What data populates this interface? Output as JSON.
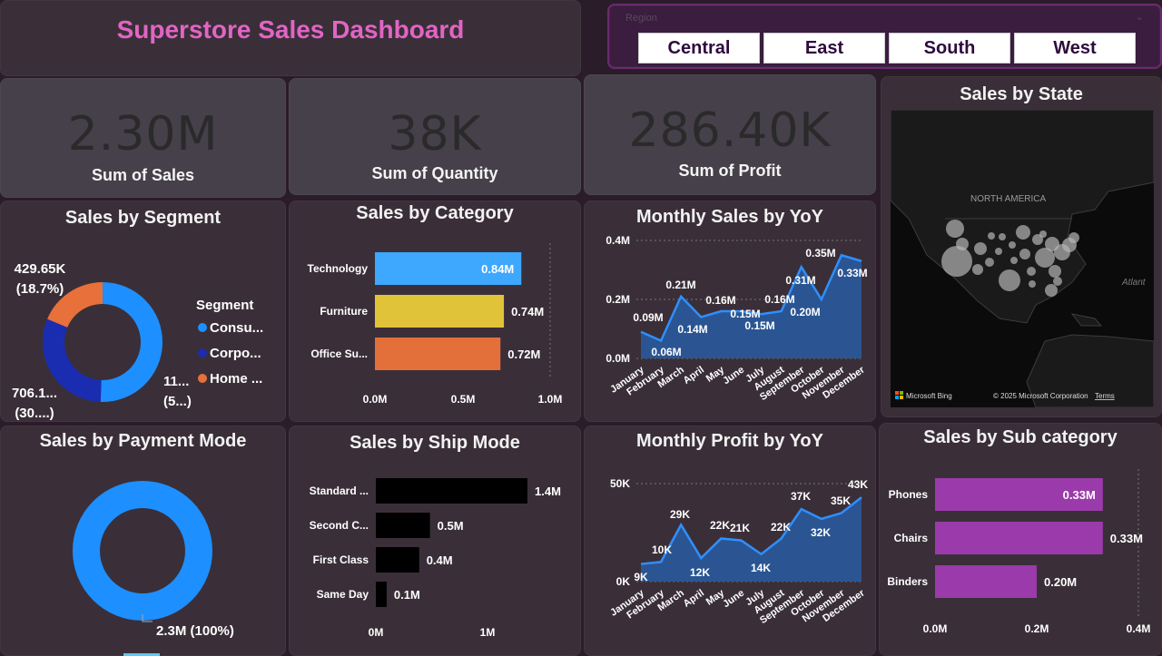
{
  "title": "Superstore Sales Dashboard",
  "region_slicer": {
    "label": "Region",
    "options": [
      "Central",
      "East",
      "South",
      "West"
    ]
  },
  "kpis": [
    {
      "value": "2.30M",
      "label": "Sum of Sales"
    },
    {
      "value": "38K",
      "label": "Sum of Quantity"
    },
    {
      "value": "286.40K",
      "label": "Sum of Profit"
    }
  ],
  "map": {
    "title": "Sales by State",
    "region_label": "NORTH AMERICA",
    "ocean_label": "Atlant",
    "provider": "Microsoft Bing",
    "copyright": "© 2025 Microsoft Corporation",
    "terms": "Terms"
  },
  "colors": {
    "bg": "#2b1c2a",
    "card": "#3a2f38",
    "title_pink": "#e065c4",
    "blue": "#1e8fff",
    "navy": "#1a2db0",
    "orange": "#e8703a",
    "tech_blue": "#3ea8ff",
    "furn_yellow": "#e1c33a",
    "office_orange": "#e3703a",
    "area_fill": "#2a5592",
    "area_line": "#2f8fff",
    "purple": "#9b3aab"
  },
  "chart_data": [
    {
      "id": "segment",
      "type": "pie",
      "title": "Sales by Segment",
      "legend_title": "Segment",
      "legend": [
        "Consu...",
        "Corpo...",
        "Home ..."
      ],
      "values": [
        1160000,
        706100,
        429650
      ],
      "labels": [
        "11...\n(5...)",
        "706.1...\n(30....)",
        "429.65K\n(18.7%)"
      ],
      "colors": [
        "#1e8fff",
        "#1a2db0",
        "#e8703a"
      ]
    },
    {
      "id": "category",
      "type": "bar",
      "title": "Sales by Category",
      "categories": [
        "Technology",
        "Furniture",
        "Office Su..."
      ],
      "values": [
        0.84,
        0.74,
        0.72
      ],
      "value_labels": [
        "0.84M",
        "0.74M",
        "0.72M"
      ],
      "colors": [
        "#3ea8ff",
        "#e1c33a",
        "#e3703a"
      ],
      "xlim": [
        0,
        1
      ],
      "xticks": [
        "0.0M",
        "0.5M",
        "1.0M"
      ]
    },
    {
      "id": "monthly_sales",
      "type": "area",
      "title": "Monthly Sales by YoY",
      "x": [
        "January",
        "February",
        "March",
        "April",
        "May",
        "June",
        "July",
        "August",
        "September",
        "October",
        "November",
        "December"
      ],
      "values": [
        0.09,
        0.06,
        0.21,
        0.14,
        0.16,
        0.16,
        0.15,
        0.16,
        0.31,
        0.2,
        0.35,
        0.33
      ],
      "value_labels": [
        "0.09M",
        "0.06M",
        "0.21M",
        "0.14M",
        "0.16M",
        "",
        "0.15M",
        "0.15M",
        "0.16M",
        "0.31M",
        "0.20M",
        "0.35M",
        "0.33M"
      ],
      "ylim": [
        0,
        0.4
      ],
      "yticks": [
        "0.0M",
        "0.2M",
        "0.4M"
      ]
    },
    {
      "id": "payment",
      "type": "pie",
      "title": "Sales by Payment Mode",
      "values": [
        2.3
      ],
      "labels": [
        "2.3M (100%)"
      ],
      "colors": [
        "#1e8fff"
      ]
    },
    {
      "id": "ship",
      "type": "bar",
      "title": "Sales by Ship Mode",
      "categories": [
        "Standard ...",
        "Second C...",
        "First Class",
        "Same Day"
      ],
      "values": [
        1.4,
        0.5,
        0.4,
        0.1
      ],
      "value_labels": [
        "1.4M",
        "0.5M",
        "0.4M",
        "0.1M"
      ],
      "xlim": [
        0,
        1.4
      ],
      "xticks": [
        "0M",
        "1M"
      ]
    },
    {
      "id": "monthly_profit",
      "type": "area",
      "title": "Monthly Profit by YoY",
      "x": [
        "January",
        "February",
        "March",
        "April",
        "May",
        "June",
        "July",
        "August",
        "September",
        "October",
        "November",
        "December"
      ],
      "values": [
        9,
        10,
        29,
        12,
        22,
        21,
        14,
        22,
        37,
        32,
        35,
        43
      ],
      "value_labels": [
        "9K",
        "10K",
        "29K",
        "12K",
        "22K",
        "21K",
        "14K",
        "22K",
        "37K",
        "32K",
        "35K",
        "43K"
      ],
      "ylim": [
        0,
        50
      ],
      "yticks": [
        "0K",
        "50K"
      ]
    },
    {
      "id": "subcategory",
      "type": "bar",
      "title": "Sales by Sub category",
      "categories": [
        "Phones",
        "Chairs",
        "Binders"
      ],
      "values": [
        0.33,
        0.33,
        0.2
      ],
      "value_labels": [
        "0.33M",
        "0.33M",
        "0.20M"
      ],
      "xlim": [
        0,
        0.4
      ],
      "xticks": [
        "0.0M",
        "0.2M",
        "0.4M"
      ]
    }
  ]
}
